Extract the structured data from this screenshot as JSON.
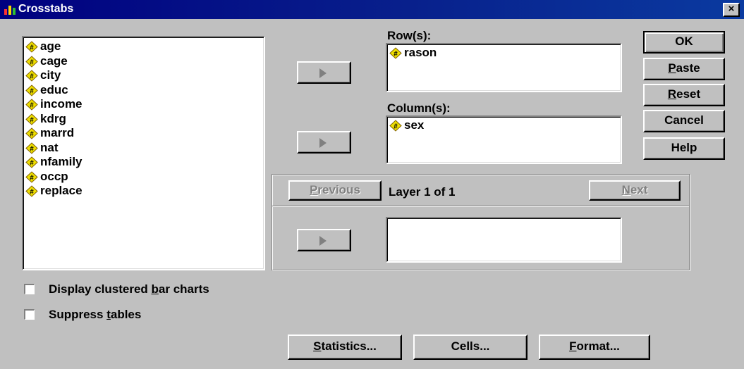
{
  "window": {
    "title": "Crosstabs",
    "close_glyph": "×"
  },
  "source_variables": [
    "age",
    "cage",
    "city",
    "educ",
    "income",
    "kdrg",
    "marrd",
    "nat",
    "nfamily",
    "occp",
    "replace"
  ],
  "rows": {
    "label": "Row(s):",
    "items": [
      "rason"
    ]
  },
  "columns": {
    "label": "Column(s):",
    "items": [
      "sex"
    ]
  },
  "layer": {
    "previous": "Previous",
    "text": "Layer 1 of 1",
    "next": "Next"
  },
  "buttons": {
    "ok": "OK",
    "paste": "Paste",
    "reset": "Reset",
    "cancel": "Cancel",
    "help": "Help"
  },
  "options": {
    "clustered": {
      "pre": "Display clustered ",
      "mnemonic": "b",
      "post": "ar charts",
      "checked": false
    },
    "suppress": {
      "pre": "Suppress ",
      "mnemonic": "t",
      "post": "ables",
      "checked": false
    }
  },
  "bottom_buttons": {
    "statistics": "Statistics...",
    "cells": "Cells...",
    "format": "Format..."
  },
  "icons": {
    "variable": "numeric-variable-icon",
    "arrow": "right-arrow-icon"
  },
  "colors": {
    "titlebar": "#000080",
    "face": "#c0c0c0",
    "icon_fill": "#f0e000"
  }
}
